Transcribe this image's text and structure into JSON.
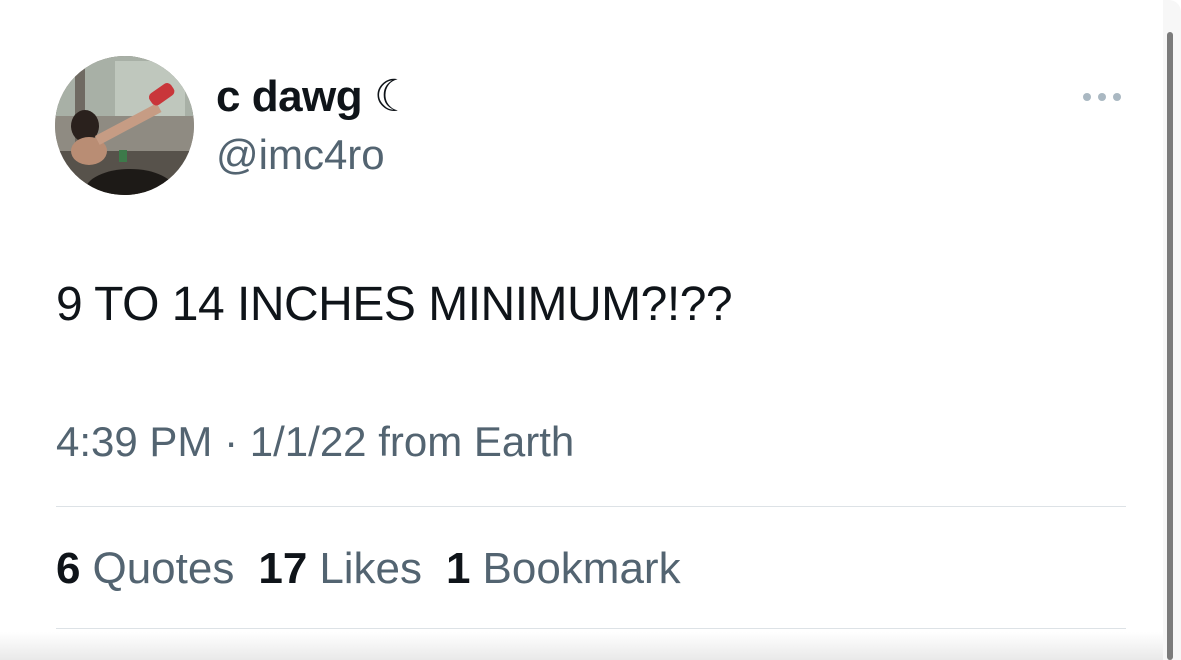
{
  "tweet": {
    "author": {
      "display_name": "c dawg ☾",
      "handle": "@imc4ro",
      "avatar_icon": "profile-photo"
    },
    "more_icon": "more-horizontal-icon",
    "text": "9 TO 14 INCHES MINIMUM?!??",
    "meta": {
      "time": "4:39 PM",
      "separator": "·",
      "date": "1/1/22",
      "source": "from Earth"
    },
    "stats": [
      {
        "count": "6",
        "label": "Quotes"
      },
      {
        "count": "17",
        "label": "Likes"
      },
      {
        "count": "1",
        "label": "Bookmark"
      }
    ]
  },
  "colors": {
    "primary_text": "#0f1419",
    "secondary_text": "#536471",
    "divider": "#dde2e6"
  }
}
